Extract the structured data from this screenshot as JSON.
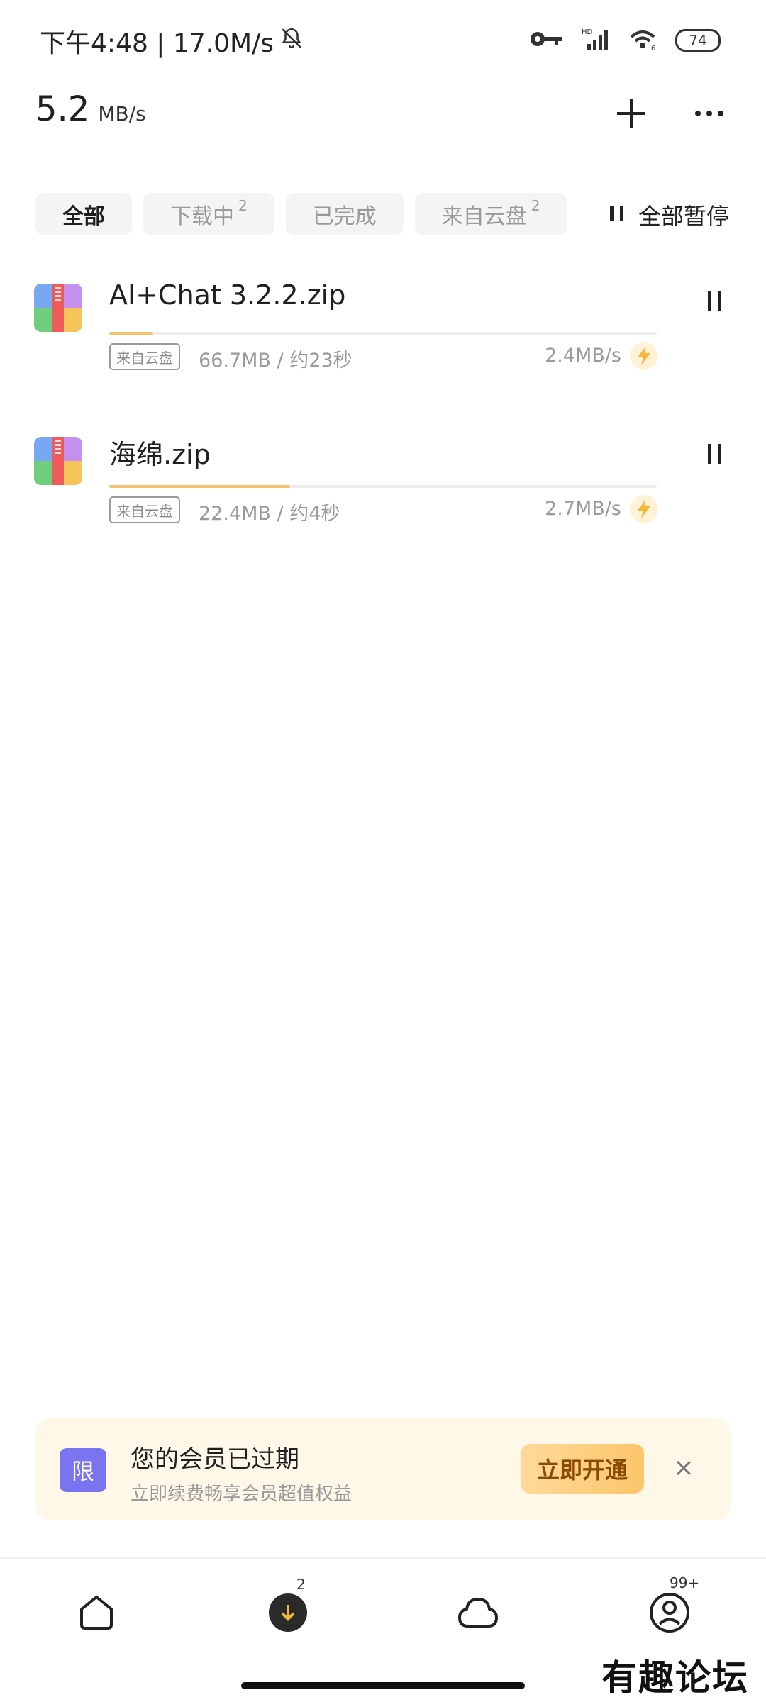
{
  "status_bar": {
    "time_speed": "下午4:48 | 17.0M/s",
    "battery": "74",
    "icons": [
      "bell-off-icon",
      "key-icon",
      "signal-icon",
      "wifi-icon",
      "battery-icon"
    ]
  },
  "header": {
    "speed_value": "5.2",
    "speed_unit": "MB/s",
    "icons": [
      "add-icon",
      "more-icon"
    ]
  },
  "tabs": [
    {
      "label": "全部",
      "count": ""
    },
    {
      "label": "下载中",
      "count": "2"
    },
    {
      "label": "已完成",
      "count": ""
    },
    {
      "label": "来自云盘",
      "count": "2"
    }
  ],
  "pause_all_label": "全部暂停",
  "downloads": [
    {
      "name": "AI+Chat 3.2.2.zip",
      "source": "来自云盘",
      "meta": "66.7MB / 约23秒",
      "rate": "2.4MB/s",
      "progress": 0.08
    },
    {
      "name": "海绵.zip",
      "source": "来自云盘",
      "meta": "22.4MB / 约4秒",
      "rate": "2.7MB/s",
      "progress": 0.33
    }
  ],
  "banner": {
    "badge": "限",
    "title": "您的会员已过期",
    "subtitle": "立即续费畅享会员超值权益",
    "button": "立即开通"
  },
  "bottom_nav": {
    "download_badge": "2",
    "profile_badge": "99+"
  },
  "watermark": "有趣论坛",
  "colors": {
    "accent": "#f3c36f",
    "banner_bg": "#fff7e8",
    "limit_badge": "#7b74f0"
  }
}
